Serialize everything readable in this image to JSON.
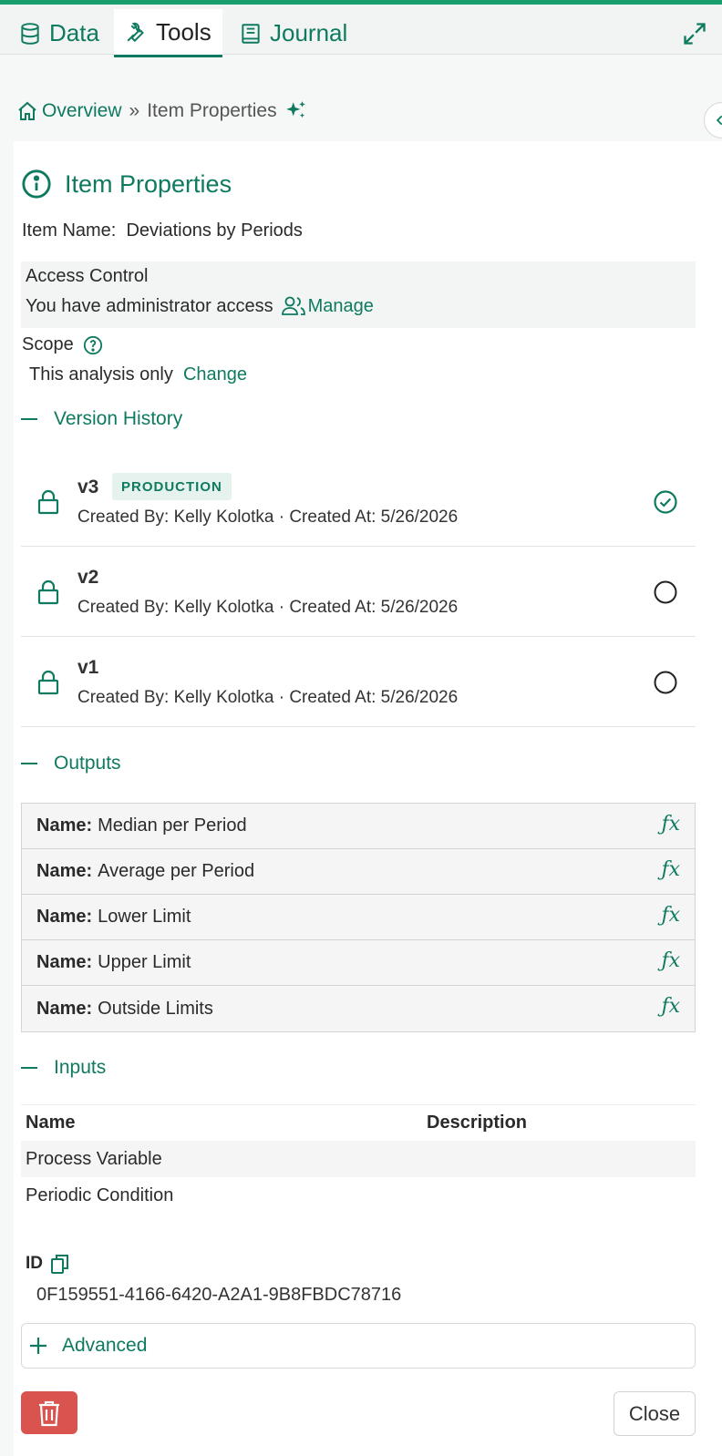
{
  "tabs": [
    {
      "label": "Data",
      "icon": "database-icon"
    },
    {
      "label": "Tools",
      "icon": "wrench-icon",
      "active": true
    },
    {
      "label": "Journal",
      "icon": "book-icon"
    }
  ],
  "breadcrumb": {
    "home": "Overview",
    "separator": "»",
    "current": "Item Properties"
  },
  "title": "Item Properties",
  "item_name": {
    "label": "Item Name:",
    "value": "Deviations by Periods"
  },
  "access": {
    "label": "Access Control",
    "text": "You have administrator access",
    "manage": "Manage"
  },
  "scope": {
    "label": "Scope",
    "value": "This analysis only",
    "change": "Change"
  },
  "version_history": {
    "title": "Version History",
    "versions": [
      {
        "name": "v3",
        "badge": "PRODUCTION",
        "meta": "Created By: Kelly Kolotka · Created At: 5/26/2026",
        "selected": true
      },
      {
        "name": "v2",
        "badge": "",
        "meta": "Created By: Kelly Kolotka · Created At: 5/26/2026",
        "selected": false
      },
      {
        "name": "v1",
        "badge": "",
        "meta": "Created By: Kelly Kolotka · Created At: 5/26/2026",
        "selected": false
      }
    ]
  },
  "outputs": {
    "title": "Outputs",
    "name_label": "Name:",
    "fx": "ƒx",
    "items": [
      "Median per Period",
      "Average per Period",
      "Lower Limit",
      "Upper Limit",
      "Outside Limits"
    ]
  },
  "inputs": {
    "title": "Inputs",
    "headers": {
      "name": "Name",
      "description": "Description"
    },
    "rows": [
      {
        "name": "Process Variable",
        "description": ""
      },
      {
        "name": "Periodic Condition",
        "description": ""
      }
    ]
  },
  "id": {
    "label": "ID",
    "value": "0F159551-4166-6420-A2A1-9B8FBDC78716"
  },
  "advanced": "Advanced",
  "close": "Close",
  "colors": {
    "accent": "#0e7a5f",
    "top_border": "#1a9e6e",
    "danger": "#d9534f"
  }
}
